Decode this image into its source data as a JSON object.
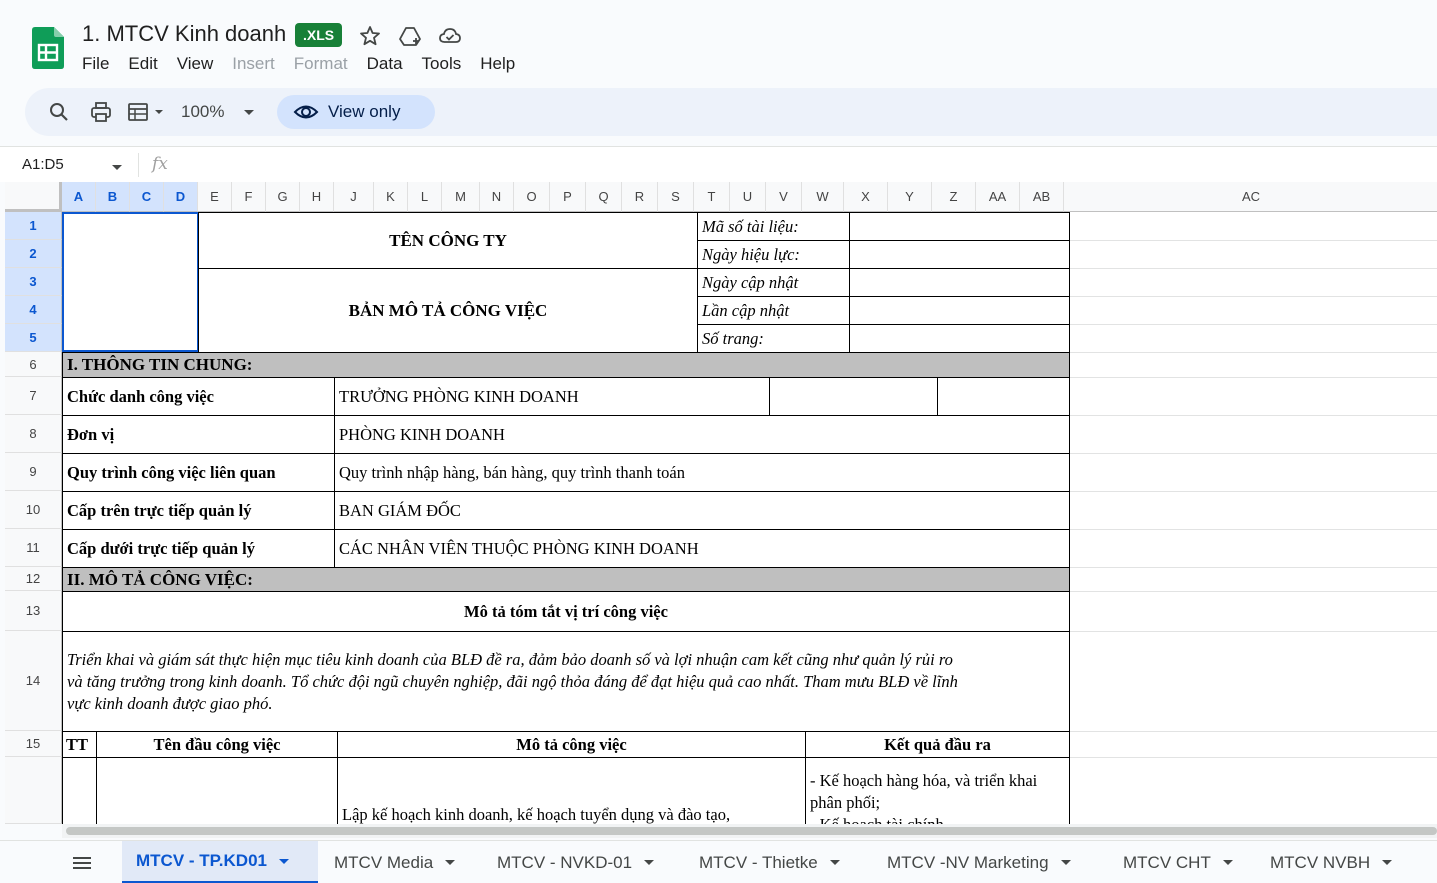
{
  "header": {
    "doc_title": "1. MTCV Kinh doanh",
    "badge": ".XLS",
    "menu": [
      "File",
      "Edit",
      "View",
      "Insert",
      "Format",
      "Data",
      "Tools",
      "Help"
    ]
  },
  "toolbar": {
    "zoom": "100%",
    "view_only": "View only"
  },
  "formula_bar": {
    "name_box": "A1:D5",
    "fx": "fx"
  },
  "columns": [
    "A",
    "B",
    "C",
    "D",
    "E",
    "F",
    "G",
    "H",
    "J",
    "K",
    "L",
    "M",
    "N",
    "O",
    "P",
    "Q",
    "R",
    "S",
    "T",
    "U",
    "V",
    "W",
    "X",
    "Y",
    "Z",
    "AA",
    "AB",
    "AC"
  ],
  "rows": [
    "1",
    "2",
    "3",
    "4",
    "5",
    "6",
    "7",
    "8",
    "9",
    "10",
    "11",
    "12",
    "13",
    "14",
    "15"
  ],
  "sheet": {
    "company": "TÊN CÔNG TY",
    "doc_name": "BẢN MÔ TẢ CÔNG VIỆC",
    "meta_labels": [
      "Mã số tài liệu:",
      "Ngày hiệu lực:",
      "Ngày cập nhật",
      "Lần cập nhật",
      "Số trang:"
    ],
    "section1": "I. THÔNG TIN CHUNG:",
    "info": [
      {
        "label": "Chức danh công việc",
        "value": "TRƯỞNG PHÒNG KINH DOANH"
      },
      {
        "label": "Đơn vị",
        "value": "PHÒNG KINH DOANH"
      },
      {
        "label": "Quy trình công việc liên quan",
        "value": "Quy trình nhập hàng, bán hàng, quy trình thanh toán"
      },
      {
        "label": "Cấp trên trực tiếp quản lý",
        "value": "BAN GIÁM ĐỐC"
      },
      {
        "label": "Cấp dưới trực tiếp quản lý",
        "value": "CÁC NHÂN VIÊN THUỘC PHÒNG KINH DOANH"
      }
    ],
    "section2": "II. MÔ TẢ CÔNG VIỆC:",
    "summary_title": "Mô tả tóm tắt vị trí công việc",
    "summary_lines": [
      "Triển khai và giám sát thực hiện mục tiêu kinh doanh của BLĐ đề ra, đảm bảo doanh số và lợi nhuận cam kết cũng như quản lý rủi ro",
      "và tăng trưởng trong kinh doanh. Tổ chức đội ngũ chuyên nghiệp, đãi ngộ thỏa đáng để đạt hiệu quả cao nhất. Tham mưu BLĐ về lĩnh",
      "vực kinh doanh được giao phó."
    ],
    "table_headers": [
      "TT",
      "Tên đầu công việc",
      "Mô tả công việc",
      "Kết quả đầu ra"
    ],
    "row16_desc": "Lập kế hoạch  kinh doanh, kế hoạch tuyển dụng  và đào tạo,",
    "row16_result_lines": [
      "- Kế hoạch hàng hóa, và triển khai",
      "phân phối;",
      "- Kế hoạch tài chính..."
    ]
  },
  "tabs": [
    "MTCV - TP.KD01",
    "MTCV Media",
    "MTCV - NVKD-01",
    "MTCV - Thietke",
    "MTCV -NV Marketing",
    "MTCV CHT",
    "MTCV NVBH"
  ]
}
